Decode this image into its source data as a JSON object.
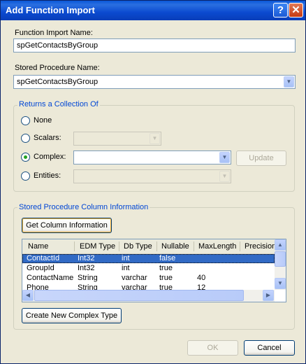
{
  "window": {
    "title": "Add Function Import",
    "help_glyph": "?",
    "close_glyph": "✕"
  },
  "function_import": {
    "label": "Function Import Name:",
    "value": "spGetContactsByGroup"
  },
  "stored_procedure": {
    "label": "Stored Procedure Name:",
    "value": "spGetContactsByGroup"
  },
  "returns": {
    "group_label": "Returns a Collection Of",
    "options": [
      {
        "label": "None",
        "selected": false
      },
      {
        "label": "Scalars:",
        "selected": false
      },
      {
        "label": "Complex:",
        "selected": true
      },
      {
        "label": "Entities:",
        "selected": false
      }
    ],
    "complex_value": "",
    "update_label": "Update"
  },
  "column_info": {
    "group_label": "Stored Procedure Column Information",
    "get_button": "Get Column Information",
    "headers": [
      "Name",
      "EDM Type",
      "Db Type",
      "Nullable",
      "MaxLength",
      "Precision"
    ],
    "rows": [
      {
        "name": "ContactId",
        "edm": "Int32",
        "db": "int",
        "nullable": "false",
        "maxlen": ""
      },
      {
        "name": "GroupId",
        "edm": "Int32",
        "db": "int",
        "nullable": "true",
        "maxlen": ""
      },
      {
        "name": "ContactName",
        "edm": "String",
        "db": "varchar",
        "nullable": "true",
        "maxlen": "40"
      },
      {
        "name": "Phone",
        "edm": "String",
        "db": "varchar",
        "nullable": "true",
        "maxlen": "12"
      }
    ],
    "create_button": "Create New Complex Type"
  },
  "footer": {
    "ok": "OK",
    "cancel": "Cancel"
  },
  "colors": {
    "title_bar": "#0a58d8",
    "group_label": "#0046d5",
    "selection": "#316ac5"
  }
}
